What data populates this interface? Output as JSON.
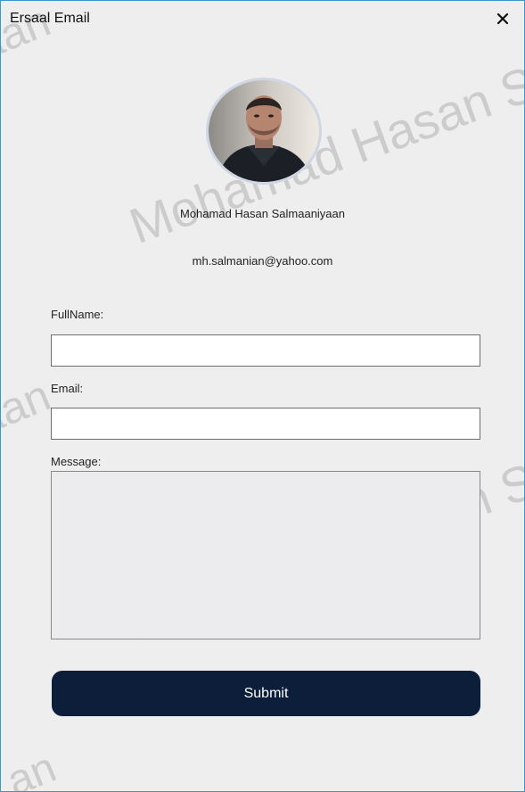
{
  "window": {
    "title": "Ersaal Email",
    "close_icon": "close-icon"
  },
  "profile": {
    "avatar_icon": "profile-photo",
    "name": "Mohamad Hasan Salmaaniyaan",
    "email": "mh.salmanian@yahoo.com"
  },
  "form": {
    "fullname_label": "FullName:",
    "fullname_value": "",
    "email_label": "Email:",
    "email_value": "",
    "message_label": "Message:",
    "message_value": "",
    "submit_label": "Submit"
  },
  "watermark": {
    "fragment_top_left": "aan",
    "middle_line": "Mohamad Hasan S",
    "fragment_left_middle": "aan",
    "bottom_line": "Mohamad Hasan S",
    "fragment_bottom_left": "an"
  },
  "colors": {
    "window_border": "#3a97c9",
    "background": "#eeeeef",
    "submit_background": "#0d1e3b",
    "submit_text": "#ffffff"
  }
}
